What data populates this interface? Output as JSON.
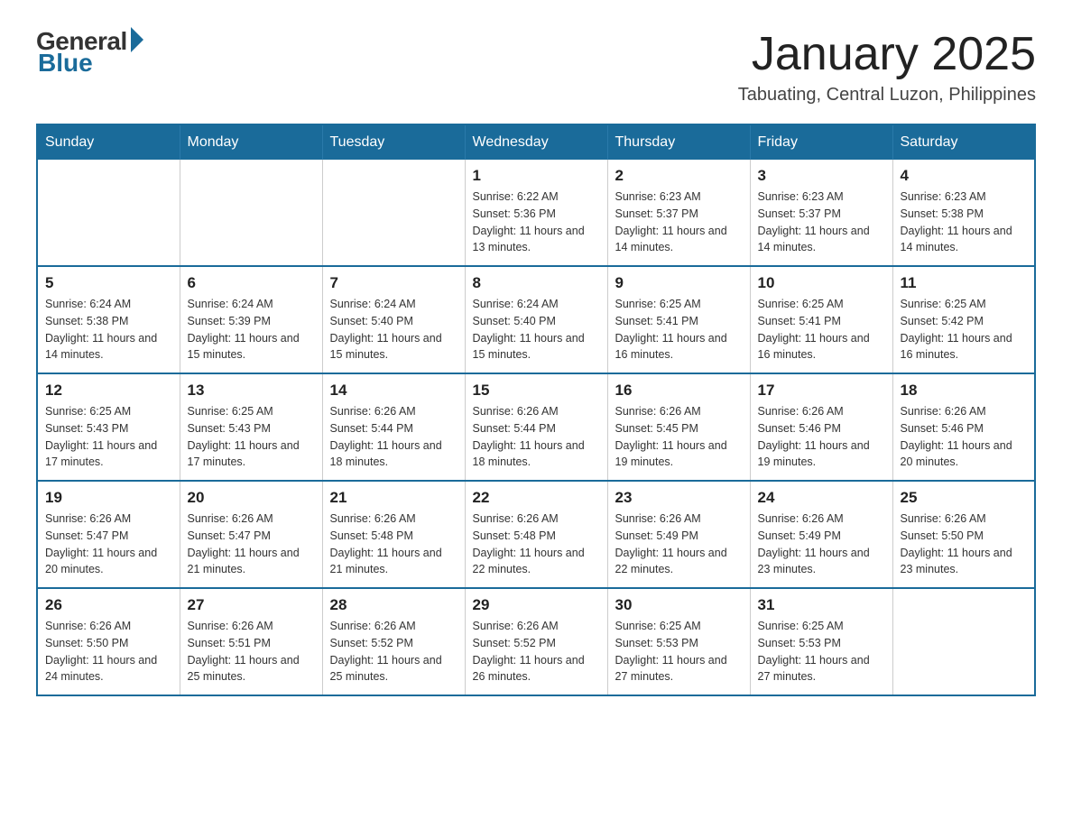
{
  "logo": {
    "general": "General",
    "blue": "Blue"
  },
  "header": {
    "month": "January 2025",
    "location": "Tabuating, Central Luzon, Philippines"
  },
  "weekdays": [
    "Sunday",
    "Monday",
    "Tuesday",
    "Wednesday",
    "Thursday",
    "Friday",
    "Saturday"
  ],
  "weeks": [
    [
      {
        "day": "",
        "info": ""
      },
      {
        "day": "",
        "info": ""
      },
      {
        "day": "",
        "info": ""
      },
      {
        "day": "1",
        "info": "Sunrise: 6:22 AM\nSunset: 5:36 PM\nDaylight: 11 hours and 13 minutes."
      },
      {
        "day": "2",
        "info": "Sunrise: 6:23 AM\nSunset: 5:37 PM\nDaylight: 11 hours and 14 minutes."
      },
      {
        "day": "3",
        "info": "Sunrise: 6:23 AM\nSunset: 5:37 PM\nDaylight: 11 hours and 14 minutes."
      },
      {
        "day": "4",
        "info": "Sunrise: 6:23 AM\nSunset: 5:38 PM\nDaylight: 11 hours and 14 minutes."
      }
    ],
    [
      {
        "day": "5",
        "info": "Sunrise: 6:24 AM\nSunset: 5:38 PM\nDaylight: 11 hours and 14 minutes."
      },
      {
        "day": "6",
        "info": "Sunrise: 6:24 AM\nSunset: 5:39 PM\nDaylight: 11 hours and 15 minutes."
      },
      {
        "day": "7",
        "info": "Sunrise: 6:24 AM\nSunset: 5:40 PM\nDaylight: 11 hours and 15 minutes."
      },
      {
        "day": "8",
        "info": "Sunrise: 6:24 AM\nSunset: 5:40 PM\nDaylight: 11 hours and 15 minutes."
      },
      {
        "day": "9",
        "info": "Sunrise: 6:25 AM\nSunset: 5:41 PM\nDaylight: 11 hours and 16 minutes."
      },
      {
        "day": "10",
        "info": "Sunrise: 6:25 AM\nSunset: 5:41 PM\nDaylight: 11 hours and 16 minutes."
      },
      {
        "day": "11",
        "info": "Sunrise: 6:25 AM\nSunset: 5:42 PM\nDaylight: 11 hours and 16 minutes."
      }
    ],
    [
      {
        "day": "12",
        "info": "Sunrise: 6:25 AM\nSunset: 5:43 PM\nDaylight: 11 hours and 17 minutes."
      },
      {
        "day": "13",
        "info": "Sunrise: 6:25 AM\nSunset: 5:43 PM\nDaylight: 11 hours and 17 minutes."
      },
      {
        "day": "14",
        "info": "Sunrise: 6:26 AM\nSunset: 5:44 PM\nDaylight: 11 hours and 18 minutes."
      },
      {
        "day": "15",
        "info": "Sunrise: 6:26 AM\nSunset: 5:44 PM\nDaylight: 11 hours and 18 minutes."
      },
      {
        "day": "16",
        "info": "Sunrise: 6:26 AM\nSunset: 5:45 PM\nDaylight: 11 hours and 19 minutes."
      },
      {
        "day": "17",
        "info": "Sunrise: 6:26 AM\nSunset: 5:46 PM\nDaylight: 11 hours and 19 minutes."
      },
      {
        "day": "18",
        "info": "Sunrise: 6:26 AM\nSunset: 5:46 PM\nDaylight: 11 hours and 20 minutes."
      }
    ],
    [
      {
        "day": "19",
        "info": "Sunrise: 6:26 AM\nSunset: 5:47 PM\nDaylight: 11 hours and 20 minutes."
      },
      {
        "day": "20",
        "info": "Sunrise: 6:26 AM\nSunset: 5:47 PM\nDaylight: 11 hours and 21 minutes."
      },
      {
        "day": "21",
        "info": "Sunrise: 6:26 AM\nSunset: 5:48 PM\nDaylight: 11 hours and 21 minutes."
      },
      {
        "day": "22",
        "info": "Sunrise: 6:26 AM\nSunset: 5:48 PM\nDaylight: 11 hours and 22 minutes."
      },
      {
        "day": "23",
        "info": "Sunrise: 6:26 AM\nSunset: 5:49 PM\nDaylight: 11 hours and 22 minutes."
      },
      {
        "day": "24",
        "info": "Sunrise: 6:26 AM\nSunset: 5:49 PM\nDaylight: 11 hours and 23 minutes."
      },
      {
        "day": "25",
        "info": "Sunrise: 6:26 AM\nSunset: 5:50 PM\nDaylight: 11 hours and 23 minutes."
      }
    ],
    [
      {
        "day": "26",
        "info": "Sunrise: 6:26 AM\nSunset: 5:50 PM\nDaylight: 11 hours and 24 minutes."
      },
      {
        "day": "27",
        "info": "Sunrise: 6:26 AM\nSunset: 5:51 PM\nDaylight: 11 hours and 25 minutes."
      },
      {
        "day": "28",
        "info": "Sunrise: 6:26 AM\nSunset: 5:52 PM\nDaylight: 11 hours and 25 minutes."
      },
      {
        "day": "29",
        "info": "Sunrise: 6:26 AM\nSunset: 5:52 PM\nDaylight: 11 hours and 26 minutes."
      },
      {
        "day": "30",
        "info": "Sunrise: 6:25 AM\nSunset: 5:53 PM\nDaylight: 11 hours and 27 minutes."
      },
      {
        "day": "31",
        "info": "Sunrise: 6:25 AM\nSunset: 5:53 PM\nDaylight: 11 hours and 27 minutes."
      },
      {
        "day": "",
        "info": ""
      }
    ]
  ]
}
